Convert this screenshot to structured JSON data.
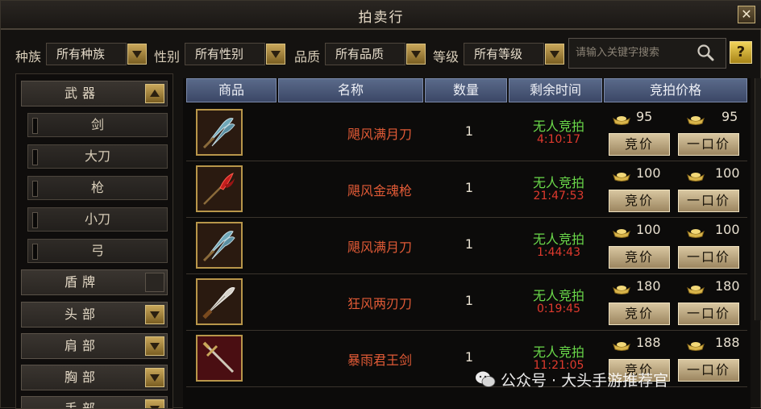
{
  "window": {
    "title": "拍卖行",
    "close_label": "✕"
  },
  "filters": [
    {
      "label": "种族",
      "value": "所有种族"
    },
    {
      "label": "性别",
      "value": "所有性别"
    },
    {
      "label": "品质",
      "value": "所有品质"
    },
    {
      "label": "等级",
      "value": "所有等级"
    }
  ],
  "search": {
    "placeholder": "请输入关键字搜索"
  },
  "help_label": "?",
  "sidebar": {
    "categories": [
      {
        "label": "武器",
        "subs": [
          "剑",
          "大刀",
          "枪",
          "小刀",
          "弓"
        ]
      },
      {
        "label": "盾牌"
      },
      {
        "label": "头部"
      },
      {
        "label": "肩部"
      },
      {
        "label": "胸部"
      },
      {
        "label": "手部"
      }
    ]
  },
  "table": {
    "headers": [
      "商品",
      "名称",
      "数量",
      "剩余时间",
      "竞拍价格"
    ],
    "rows": [
      {
        "name": "飓风满月刀",
        "qty": "1",
        "status": "无人竞拍",
        "time": "4:10:17",
        "bid": "95",
        "buyout": "95",
        "bid_label": "竞价",
        "buyout_label": "一口价",
        "icon": "crescent-blade-icon"
      },
      {
        "name": "飓风金魂枪",
        "qty": "1",
        "status": "无人竞拍",
        "time": "21:47:53",
        "bid": "100",
        "buyout": "100",
        "bid_label": "竞价",
        "buyout_label": "一口价",
        "icon": "red-spear-icon"
      },
      {
        "name": "飓风满月刀",
        "qty": "1",
        "status": "无人竞拍",
        "time": "1:44:43",
        "bid": "100",
        "buyout": "100",
        "bid_label": "竞价",
        "buyout_label": "一口价",
        "icon": "crescent-blade-icon"
      },
      {
        "name": "狂风两刃刀",
        "qty": "1",
        "status": "无人竞拍",
        "time": "0:19:45",
        "bid": "180",
        "buyout": "180",
        "bid_label": "竞价",
        "buyout_label": "一口价",
        "icon": "double-edge-knife-icon"
      },
      {
        "name": "暴雨君王剑",
        "qty": "1",
        "status": "无人竞拍",
        "time": "11:21:05",
        "bid": "188",
        "buyout": "188",
        "bid_label": "竞价",
        "buyout_label": "一口价",
        "icon": "king-sword-icon"
      }
    ]
  },
  "watermark": {
    "text": "公众号 · 大头手游推荐官"
  },
  "colors": {
    "item_name": "#e05a36",
    "no_bid": "#6ad84a",
    "time": "#e03a2e",
    "gold": "#c9a75a"
  }
}
